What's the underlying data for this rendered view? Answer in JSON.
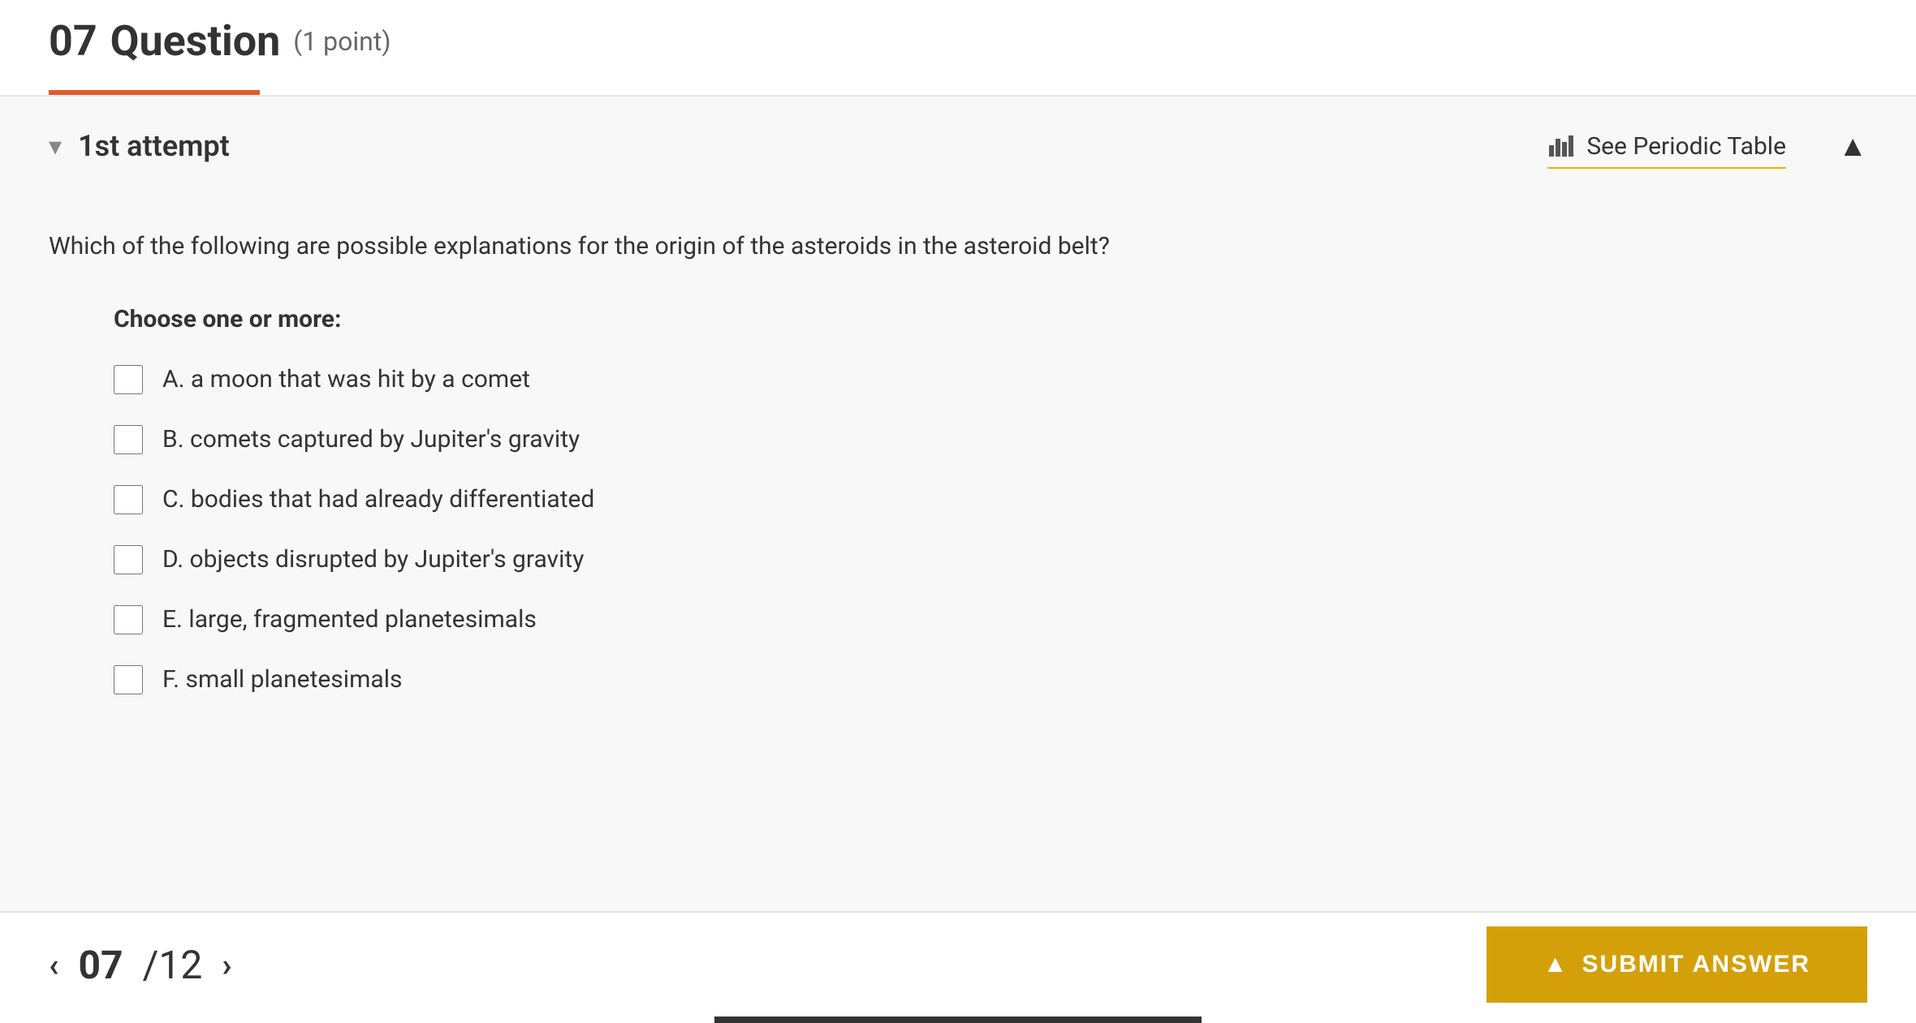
{
  "header": {
    "question_number": "07",
    "question_title": "Question",
    "question_points": "(1 point)"
  },
  "attempt": {
    "label": "1st attempt",
    "periodic_table_text": "See Periodic Table"
  },
  "question": {
    "text": "Which of the following are possible explanations for the origin of the asteroids in the asteroid belt?",
    "choose_label": "Choose one or more:",
    "options": [
      {
        "id": "A",
        "text": "A. a moon that was hit by a comet"
      },
      {
        "id": "B",
        "text": "B. comets captured by Jupiter's gravity"
      },
      {
        "id": "C",
        "text": "C. bodies that had already differentiated"
      },
      {
        "id": "D",
        "text": "D. objects disrupted by Jupiter's gravity"
      },
      {
        "id": "E",
        "text": "E.  large, fragmented planetesimals"
      },
      {
        "id": "F",
        "text": "F.  small planetesimals"
      }
    ]
  },
  "footer": {
    "page_current": "07",
    "page_total": "/12",
    "submit_label": "SUBMIT ANSWER"
  }
}
